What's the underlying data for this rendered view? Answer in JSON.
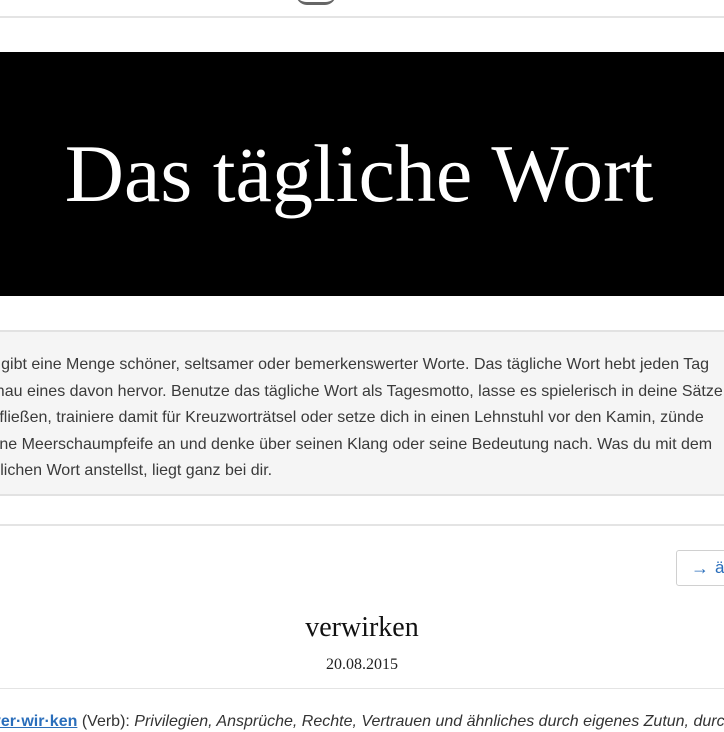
{
  "banner": {
    "title": "Das tägliche Wort"
  },
  "intro": {
    "lines": [
      "Es gibt eine Menge schöner, seltsamer oder bemerkenswerter Worte. Das tägliche Wort hebt jeden Tag",
      "genau eines davon hervor. Benutze das tägliche Wort als Tagesmotto, lasse es spielerisch in deine Sätze",
      "einfließen, trainiere damit für Kreuzworträtsel oder setze dich in einen Lehnstuhl vor den Kamin, zünde",
      "deine Meerschaumpfeife an und denke über seinen Klang oder seine Bedeutung nach. Was du mit dem",
      "täglichen Wort anstellst, liegt ganz bei dir."
    ]
  },
  "nav": {
    "older_label": "äl",
    "arrow_icon": "→"
  },
  "entry": {
    "word": "verwirken",
    "date": "20.08.2015",
    "syllables": "ver·wir·ken",
    "part_of_speech": "(Verb):",
    "definition": "Privilegien, Ansprüche, Rechte, Vertrauen und ähnliches durch eigenes Zutun, durch"
  }
}
